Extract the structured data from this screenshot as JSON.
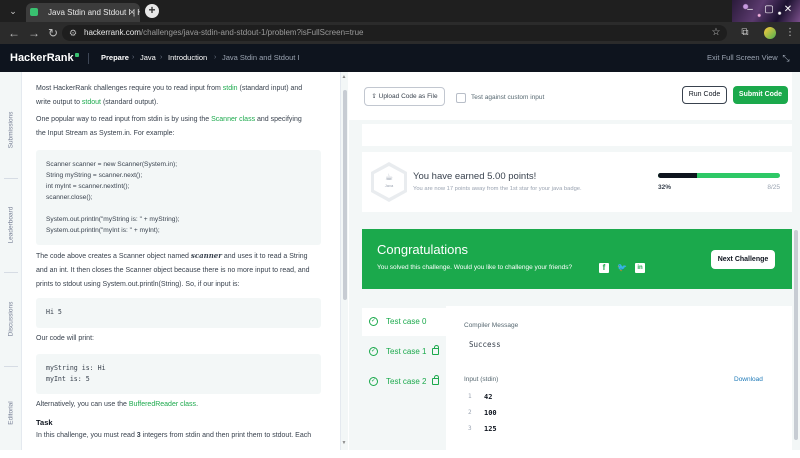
{
  "browser": {
    "tab_title": "Java Stdin and Stdout I | Hack",
    "tab_close": "×",
    "new_tab": "+",
    "url_host": "hackerrank.com",
    "url_path": "/challenges/java-stdin-and-stdout-1/problem?isFullScreen=true"
  },
  "header": {
    "logo": "HackerRank",
    "crumbs": [
      "Prepare",
      "Java",
      "Introduction",
      "Java Stdin and Stdout I"
    ],
    "exit_fullscreen": "Exit Full Screen View"
  },
  "rail": {
    "tabs": [
      "Submissions",
      "Leaderboard",
      "Discussions",
      "Editorial"
    ]
  },
  "problem": {
    "p1_a": "Most HackerRank challenges require you to read input from ",
    "p1_link1": "stdin",
    "p1_b": " (standard input) and",
    "p1_c": "write output to ",
    "p1_link2": "stdout",
    "p1_d": " (standard output).",
    "p2_a": "One popular way to read input from stdin is by using the ",
    "p2_link": "Scanner class",
    "p2_b": " and specifying",
    "p2_c": "the Input Stream as System.in. For example:",
    "code1": [
      "Scanner scanner = new Scanner(System.in);",
      "String myString = scanner.next();",
      "int myInt = scanner.nextInt();",
      "scanner.close();",
      "",
      "System.out.println(\"myString is: \" + myString);",
      "System.out.println(\"myInt is: \" + myInt);"
    ],
    "p3_a": "The code above creates a Scanner object named ",
    "p3_em": "scanner",
    "p3_b": " and uses it to read a String",
    "p3_c": "and an int. It then closes the Scanner object because there is no more input to read, and",
    "p3_d": "prints to stdout using System.out.println(String). So, if our input is:",
    "code2": [
      "Hi 5"
    ],
    "p4": "Our code will print:",
    "code3": [
      "myString is: Hi",
      "myInt is: 5"
    ],
    "p5_a": "Alternatively, you can use the ",
    "p5_link": "BufferedReader class",
    "p5_b": ".",
    "task_heading": "Task",
    "task_a": "In this challenge, you must read ",
    "task_num": "3",
    "task_b": " integers from stdin and then print them to stdout. Each"
  },
  "toolbar": {
    "upload_label": "Upload Code as File",
    "custom_input_label": "Test against custom input",
    "run_label": "Run Code",
    "submit_label": "Submit Code"
  },
  "points": {
    "badge_name": "Java",
    "title": "You have earned 5.00 points!",
    "subtitle": "You are now 17 points away from the 1st star for your java badge.",
    "progress_pct_label": "32%",
    "progress_max_label": "8/25",
    "progress_dark_fraction": 0.32,
    "progress_green_fraction": 1.0
  },
  "congrats": {
    "title": "Congratulations",
    "subtitle": "You solved this challenge. Would you like to challenge your friends?",
    "next_label": "Next Challenge",
    "color": "#1ba94c"
  },
  "results": {
    "test_cases": [
      {
        "label": "Test case 0",
        "locked": false,
        "active": true
      },
      {
        "label": "Test case 1",
        "locked": true,
        "active": false
      },
      {
        "label": "Test case 2",
        "locked": true,
        "active": false
      }
    ],
    "compiler_label": "Compiler Message",
    "compiler_value": "Success",
    "input_label": "Input (stdin)",
    "download_label": "Download",
    "input_rows": [
      {
        "n": "1",
        "v": "42"
      },
      {
        "n": "2",
        "v": "100"
      },
      {
        "n": "3",
        "v": "125"
      }
    ]
  },
  "colors": {
    "brand_green": "#1ba94c",
    "header_bg": "#0e141e",
    "link_blue": "#1f7ab8"
  }
}
